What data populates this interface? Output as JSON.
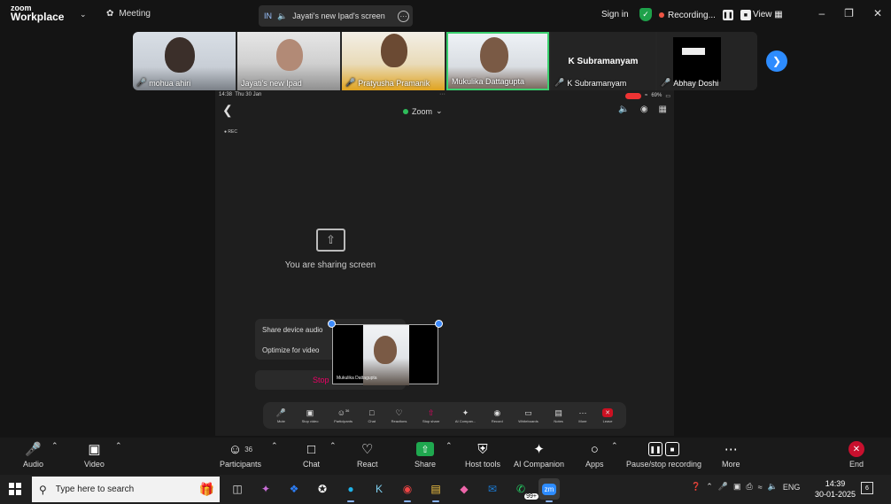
{
  "app": {
    "brand_top": "zoom",
    "brand_bottom": "Workplace",
    "meeting_label": "Meeting"
  },
  "share_pill": {
    "initials": "IN",
    "label": "Jayati's new Ipad's screen"
  },
  "top_right": {
    "sign_in": "Sign in",
    "recording": "Recording...",
    "view": "View"
  },
  "participants": [
    {
      "name": "mohua ahiri",
      "muted": true
    },
    {
      "name": "Jayati's new Ipad",
      "muted": false
    },
    {
      "name": "Pratyusha Pramanik",
      "muted": true
    },
    {
      "name": "Mukulika Dattagupta",
      "muted": false
    },
    {
      "name": "K Subramanyam",
      "big_name": "K Subramanyam",
      "muted": true
    },
    {
      "name": "Abhay Doshi",
      "muted": true
    }
  ],
  "shared_screen": {
    "status_time": "14:38",
    "status_date": "Thu 30 Jan",
    "battery": "69%",
    "zoom_label": "Zoom",
    "rec_tag": "REC",
    "sharing_text": "You are sharing screen",
    "menu_item_1": "Share device audio",
    "menu_item_2": "Optimize for video",
    "stop_label": "Stop",
    "self_view_name": "Mukulika Dattagupta",
    "ipad_toolbar": [
      {
        "label": "Mute",
        "icon": "mic-icon"
      },
      {
        "label": "Stop video",
        "icon": "video-icon"
      },
      {
        "label": "Participants",
        "icon": "participants-icon",
        "badge": "36"
      },
      {
        "label": "Chat",
        "icon": "chat-icon"
      },
      {
        "label": "Reactions",
        "icon": "heart-icon"
      },
      {
        "label": "Stop share",
        "icon": "share-icon"
      },
      {
        "label": "AI Compan...",
        "icon": "ai-icon"
      },
      {
        "label": "Record",
        "icon": "record-icon"
      },
      {
        "label": "Whiteboards",
        "icon": "whiteboard-icon"
      },
      {
        "label": "Notes",
        "icon": "notes-icon"
      },
      {
        "label": "More",
        "icon": "more-icon"
      },
      {
        "label": "Leave",
        "icon": "leave-icon"
      }
    ]
  },
  "toolbar": {
    "audio": "Audio",
    "video": "Video",
    "participants": "Participants",
    "participants_count": "36",
    "chat": "Chat",
    "react": "React",
    "share": "Share",
    "host_tools": "Host tools",
    "ai_companion": "AI Companion",
    "apps": "Apps",
    "pause_stop": "Pause/stop recording",
    "more": "More",
    "end": "End"
  },
  "taskbar": {
    "search_placeholder": "Type here to search",
    "badge_99": "99+",
    "zoom_app": "zm",
    "lang": "ENG",
    "time": "14:39",
    "date": "30-01-2025",
    "notifications": "6"
  },
  "colors": {
    "accent_blue": "#2d8cff",
    "recording_red": "#e54444",
    "share_green": "#1fa84f",
    "end_red": "#c8102e"
  }
}
